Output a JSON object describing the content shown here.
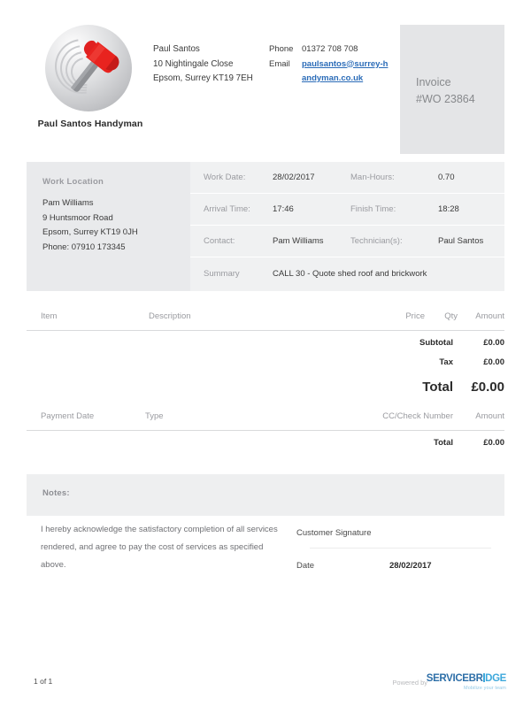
{
  "header": {
    "logo_alt": "hammer-sphere-logo",
    "company_name": "Paul Santos Handyman",
    "address_lines": [
      "Paul Santos",
      "10 Nightingale Close",
      "Epsom, Surrey KT19 7EH"
    ],
    "phone_label": "Phone",
    "phone_value": "01372 708 708",
    "email_label": "Email",
    "email_value": "paulsantos@surrey-handyman.co.uk",
    "invoice_label": "Invoice",
    "invoice_number": "#WO 23864"
  },
  "work_location": {
    "title": "Work Location",
    "lines": [
      "Pam Williams",
      "9 Huntsmoor Road",
      "Epsom, Surrey KT19 0JH",
      "Phone: 07910 173345"
    ]
  },
  "details": {
    "work_date_label": "Work Date:",
    "work_date_value": "28/02/2017",
    "man_hours_label": "Man-Hours:",
    "man_hours_value": "0.70",
    "arrival_time_label": "Arrival Time:",
    "arrival_time_value": "17:46",
    "finish_time_label": "Finish Time:",
    "finish_time_value": "18:28",
    "contact_label": "Contact:",
    "contact_value": "Pam Williams",
    "technician_label": "Technician(s):",
    "technician_value": "Paul Santos",
    "summary_label": "Summary",
    "summary_value": "CALL 30 - Quote shed roof and brickwork"
  },
  "items_table": {
    "headers": {
      "item": "Item",
      "description": "Description",
      "price": "Price",
      "qty": "Qty",
      "amount": "Amount"
    },
    "rows": [],
    "subtotal_label": "Subtotal",
    "subtotal_value": "£0.00",
    "tax_label": "Tax",
    "tax_value": "£0.00",
    "total_label": "Total",
    "total_value": "£0.00"
  },
  "payments_table": {
    "headers": {
      "payment_date": "Payment Date",
      "type": "Type",
      "cc_check_number": "CC/Check Number",
      "amount": "Amount"
    },
    "rows": [],
    "total_label": "Total",
    "total_value": "£0.00"
  },
  "notes": {
    "label": "Notes:",
    "acknowledgement": "I hereby acknowledge the satisfactory completion of all services rendered, and agree to pay the cost of services as specified above."
  },
  "signature": {
    "customer_signature_label": "Customer Signature",
    "customer_signature_value": "",
    "date_label": "Date",
    "date_value": "28/02/2017"
  },
  "footer": {
    "page_indicator": "1 of 1",
    "powered_by": "Powered by",
    "brand_part1": "SERVICEBR",
    "brand_part2": "DGE",
    "brand_tagline": "Mobilize your team"
  },
  "colors": {
    "panel_gray": "#e4e5e7",
    "work_location_gray": "#e9eaec",
    "detail_gray": "#f0f1f2",
    "notes_gray": "#eeeff0",
    "link_blue": "#2b6cb8",
    "brand_blue": "#3fa9dc",
    "muted_text": "#9a9ba0"
  }
}
